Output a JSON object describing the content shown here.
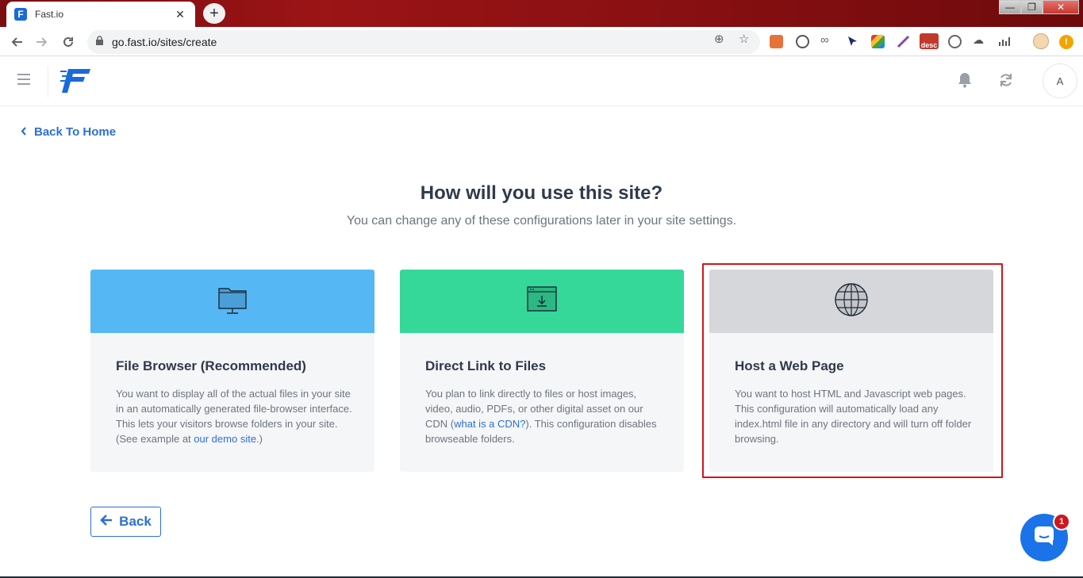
{
  "browser": {
    "tab_title": "Fast.io",
    "favicon_letter": "F",
    "close_glyph": "✕",
    "new_tab_glyph": "+",
    "url": "go.fast.io/sites/create",
    "extension_badge": "desc"
  },
  "header": {
    "avatar_letter": "A"
  },
  "page": {
    "back_home_label": "Back To Home",
    "title": "How will you use this site?",
    "subtitle": "You can change any of these configurations later in your site settings.",
    "back_button_label": "Back"
  },
  "cards": [
    {
      "title": "File Browser (Recommended)",
      "desc_before": "You want to display all of the actual files in your site in an automatically generated file-browser interface. This lets your visitors browse folders in your site. (See example at ",
      "link_text": "our demo site",
      "desc_after": ".)",
      "band_color": "#55b8f5",
      "icon": "folder-monitor-icon"
    },
    {
      "title": "Direct Link to Files",
      "desc_before": "You plan to link directly to files or host images, video, audio, PDFs, or other digital asset on our CDN (",
      "link_text": "what is a CDN?",
      "desc_after": "). This configuration disables browseable folders.",
      "band_color": "#35d899",
      "icon": "download-window-icon"
    },
    {
      "title": "Host a Web Page",
      "desc_before": "You want to host HTML and Javascript web pages. This configuration will automatically load any index.html file in any directory and will turn off folder browsing.",
      "link_text": "",
      "desc_after": "",
      "band_color": "#d6d7da",
      "icon": "globe-icon",
      "selected": true
    }
  ],
  "chat": {
    "badge_count": "1"
  },
  "colors": {
    "accent": "#2d6fd6",
    "highlight": "#d0161c"
  }
}
